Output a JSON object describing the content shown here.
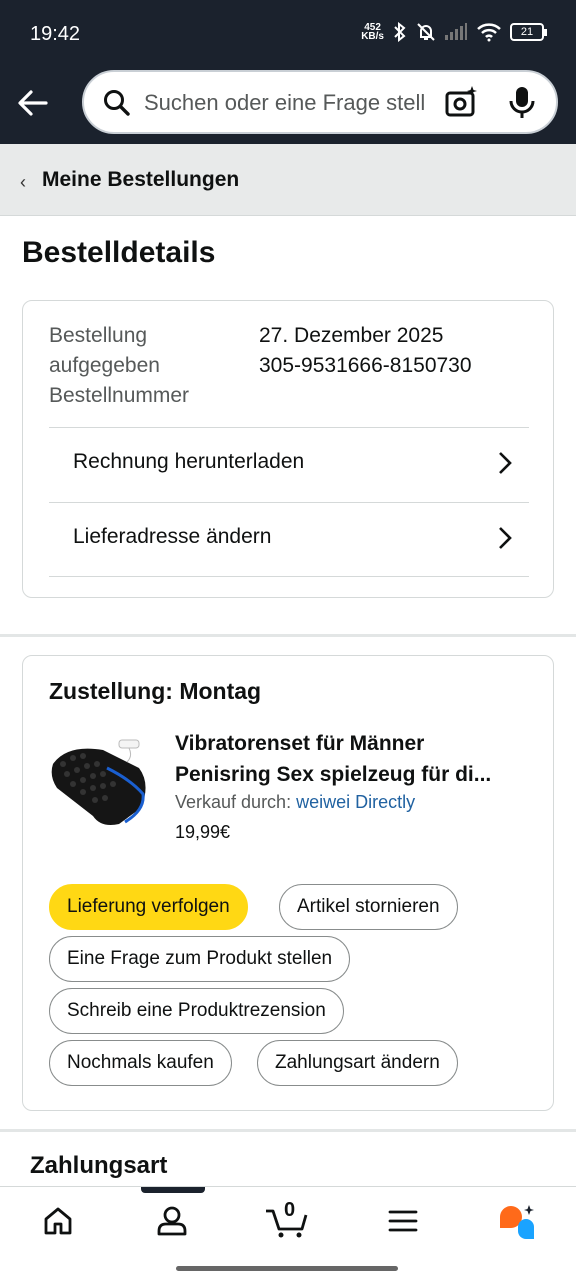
{
  "status": {
    "time": "19:42",
    "net_speed": "452",
    "net_unit": "KB/s",
    "battery": "21"
  },
  "search": {
    "placeholder": "Suchen oder eine Frage stellen"
  },
  "breadcrumb": {
    "label": "Meine Bestellungen"
  },
  "page": {
    "title": "Bestelldetails"
  },
  "order": {
    "placed_label_line1": "Bestellung",
    "placed_label_line2": "aufgegeben",
    "number_label": "Bestellnummer",
    "date": "27. Dezember 2025",
    "number": "305-9531666-8150730",
    "invoice_label": "Rechnung herunterladen",
    "address_label": "Lieferadresse ändern"
  },
  "shipment": {
    "delivery": "Zustellung: Montag",
    "product_title_line1": "Vibratorenset für Männer",
    "product_title_line2": "Penisring Sex spielzeug für di...",
    "seller_prefix": "Verkauf durch:",
    "seller_name": "weiwei Directly",
    "price": "19,99€",
    "buttons": {
      "track": "Lieferung verfolgen",
      "cancel": "Artikel stornieren",
      "question": "Eine Frage zum Produkt stellen",
      "review": "Schreib eine Produktrezension",
      "buy_again": "Nochmals kaufen",
      "payment": "Zahlungsart ändern"
    }
  },
  "payment": {
    "title": "Zahlungsart"
  },
  "tabbar": {
    "cart_count": "0"
  },
  "colors": {
    "header_bg": "#1b222d",
    "primary_button": "#ffd814",
    "link": "#2162a1"
  }
}
